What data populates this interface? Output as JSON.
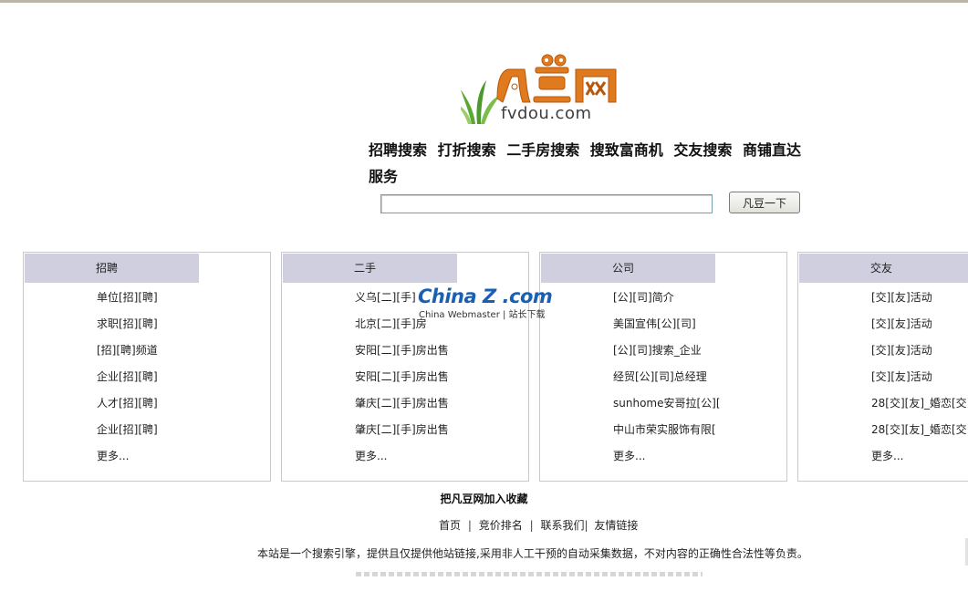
{
  "logo": {
    "brand_cn": "凡豆网",
    "domain": "fvdou.com"
  },
  "search": {
    "categories": [
      "招聘搜索",
      "打折搜索",
      "二手房搜索",
      "搜致富商机",
      "交友搜索",
      "商铺直达服务"
    ],
    "input_value": "",
    "button_label": "凡豆一下"
  },
  "panels": [
    {
      "title": "招聘",
      "items": [
        "单位[招][聘]",
        "求职[招][聘]",
        "[招][聘]频道",
        "企业[招][聘]",
        "人才[招][聘]",
        "企业[招][聘]",
        "更多..."
      ]
    },
    {
      "title": "二手",
      "items": [
        "义乌[二][手]",
        "北京[二][手]房",
        "安阳[二][手]房出售",
        "安阳[二][手]房出售",
        "肇庆[二][手]房出售",
        "肇庆[二][手]房出售",
        "更多..."
      ]
    },
    {
      "title": "公司",
      "items": [
        "[公][司]简介",
        "美国宣伟[公][司]",
        "[公][司]搜索_企业",
        "经贸[公][司]总经理",
        "sunhome安哥拉[公][",
        "中山市荣实服饰有限[",
        "更多..."
      ]
    },
    {
      "title": "交友",
      "items": [
        "[交][友]活动",
        "[交][友]活动",
        "[交][友]活动",
        "[交][友]活动",
        "28[交][友]_婚恋[交",
        "28[交][友]_婚恋[交",
        "更多..."
      ]
    }
  ],
  "watermark": {
    "main": "China Z .com",
    "sub": "China Webmaster | 站长下载"
  },
  "footer": {
    "bookmark": "把凡豆网加入收藏",
    "links": [
      "首页",
      "竞价排名",
      "联系我们",
      "友情链接"
    ],
    "disclaimer": "本站是一个搜索引擎，提供且仅提供他站链接,采用非人工干预的自动采集数据，不对内容的正确性合法性等负责。"
  },
  "colors": {
    "panel_header": "#cfcfdf",
    "logo_orange": "#e07a1f",
    "grass_green": "#5aa832"
  }
}
